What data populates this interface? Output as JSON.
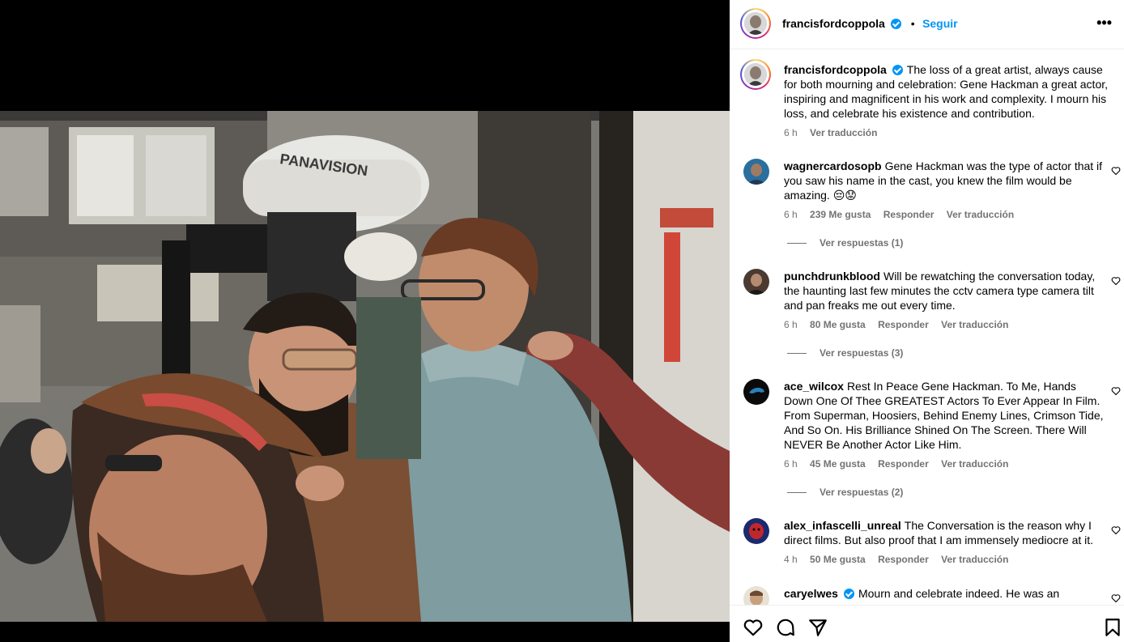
{
  "post": {
    "author": "francisfordcoppola",
    "follow_label": "Seguir",
    "separator": "•",
    "more_label": "•••",
    "caption": "The loss of a great artist, always cause for both mourning and celebration: Gene Hackman a great actor, inspiring and magnificent in his work and complexity. I mourn his loss, and celebrate his existence and contribution.",
    "caption_time": "6 h",
    "caption_translate": "Ver traducción",
    "image_text": "PANAVISION"
  },
  "comments": [
    {
      "user": "wagnercardosopb",
      "text": "Gene Hackman was the type of actor that if you saw his name in the cast, you knew the film would be amazing. 😔😟",
      "time": "6 h",
      "likes": "239 Me gusta",
      "reply": "Responder",
      "translate": "Ver traducción",
      "replies": "Ver respuestas (1)",
      "avatar_color": "#2a6f9e"
    },
    {
      "user": "punchdrunkblood",
      "text": "Will be rewatching the conversation today, the haunting last few minutes the cctv camera type camera tilt and pan freaks me out every time.",
      "time": "6 h",
      "likes": "80 Me gusta",
      "reply": "Responder",
      "translate": "Ver traducción",
      "replies": "Ver respuestas (3)",
      "avatar_color": "#4a3a30"
    },
    {
      "user": "ace_wilcox",
      "text": "Rest In Peace Gene Hackman. To Me, Hands Down One Of Thee GREATEST Actors To Ever Appear In Film. From Superman, Hoosiers, Behind Enemy Lines, Crimson Tide, And So On. His Brilliance Shined On The Screen. There Will NEVER Be Another Actor Like Him.",
      "time": "6 h",
      "likes": "45 Me gusta",
      "reply": "Responder",
      "translate": "Ver traducción",
      "replies": "Ver respuestas (2)",
      "avatar_color": "#0b0b0b"
    },
    {
      "user": "alex_infascelli_unreal",
      "text": "The Conversation is the reason why I direct films. But also proof that I am immensely mediocre at it.",
      "time": "4 h",
      "likes": "50 Me gusta",
      "reply": "Responder",
      "translate": "Ver traducción",
      "avatar_color": "#1b2a6e"
    },
    {
      "user": "caryelwes",
      "text": "Mourn and celebrate indeed. He was an",
      "avatar_color": "#c7b49a"
    }
  ],
  "colors": {
    "accent": "#0095f6",
    "muted": "#737373",
    "divider": "#efefef"
  },
  "icons": [
    "heart-icon",
    "comment-icon",
    "share-icon",
    "bookmark-icon",
    "more-options-icon",
    "verified-badge-icon"
  ]
}
